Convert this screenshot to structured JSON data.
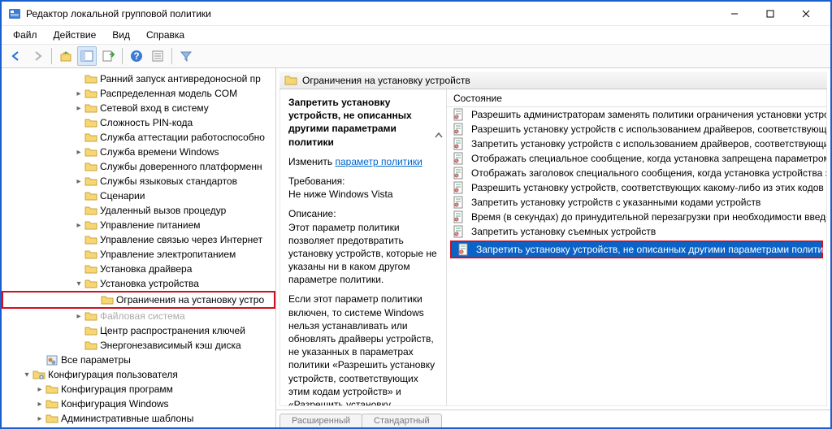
{
  "window": {
    "title": "Редактор локальной групповой политики"
  },
  "menu": {
    "file": "Файл",
    "action": "Действие",
    "view": "Вид",
    "help": "Справка"
  },
  "tree": {
    "items": [
      {
        "d": 5,
        "t": "",
        "label": "Ранний запуск антивредоносной пр"
      },
      {
        "d": 5,
        "t": ">",
        "label": "Распределенная модель COM"
      },
      {
        "d": 5,
        "t": ">",
        "label": "Сетевой вход в систему"
      },
      {
        "d": 5,
        "t": "",
        "label": "Сложность PIN-кода"
      },
      {
        "d": 5,
        "t": "",
        "label": "Служба аттестации работоспособно"
      },
      {
        "d": 5,
        "t": ">",
        "label": "Служба времени Windows"
      },
      {
        "d": 5,
        "t": "",
        "label": "Службы доверенного платформенн"
      },
      {
        "d": 5,
        "t": ">",
        "label": "Службы языковых стандартов"
      },
      {
        "d": 5,
        "t": "",
        "label": "Сценарии"
      },
      {
        "d": 5,
        "t": "",
        "label": "Удаленный вызов процедур"
      },
      {
        "d": 5,
        "t": ">",
        "label": "Управление питанием"
      },
      {
        "d": 5,
        "t": "",
        "label": "Управление связью через Интернет"
      },
      {
        "d": 5,
        "t": "",
        "label": "Управление электропитанием"
      },
      {
        "d": 5,
        "t": "",
        "label": "Установка драйвера"
      },
      {
        "d": 5,
        "t": "v",
        "label": "Установка устройства"
      },
      {
        "d": 6,
        "t": "",
        "label": "Ограничения на установку устро",
        "boxed": true
      },
      {
        "d": 5,
        "t": ">",
        "label": "Файловая система",
        "faded": true
      },
      {
        "d": 5,
        "t": "",
        "label": "Центр распространения ключей"
      },
      {
        "d": 5,
        "t": "",
        "label": "Энергонезависимый кэш диска"
      }
    ],
    "allParams": {
      "d": 2,
      "label": "Все параметры"
    },
    "userCfg": {
      "d": 1,
      "t": "v",
      "label": "Конфигурация пользователя"
    },
    "cfgProg": {
      "d": 2,
      "t": ">",
      "label": "Конфигурация программ"
    },
    "winCfg": {
      "d": 2,
      "t": ">",
      "label": "Конфигурация Windows"
    },
    "adminTpl": {
      "d": 2,
      "t": ">",
      "label": "Административные шаблоны"
    }
  },
  "rightHeader": "Ограничения на установку устройств",
  "detail": {
    "title": "Запретить установку устройств, не описанных другими параметрами политики",
    "editPrefix": "Изменить",
    "editLink": "параметр политики",
    "reqLabel": "Требования:",
    "reqText": "Не ниже Windows Vista",
    "descLabel": "Описание:",
    "descText": "Этот параметр политики позволяет предотвратить установку устройств, которые не указаны ни в каком другом параметре политики.",
    "descText2": "Если этот параметр политики включен, то системе Windows нельзя устанавливать или обновлять драйверы устройств, не указанных в параметрах политики «Разрешить установку устройств, соответствующих этим кодам устройств» и «Разрешить установку устройств для этих классов"
  },
  "listHead": "Состояние",
  "listItems": [
    "Разрешить администраторам заменять политики ограничения установки устройств",
    "Разрешить установку устройств с использованием драйверов, соответствующих этим к",
    "Запретить установку устройств с использованием драйверов, соответствующих этим к",
    "Отображать специальное сообщение, когда установка запрещена параметром полит",
    "Отображать заголовок специального сообщения, когда установка устройства запреще",
    "Разрешить установку устройств, соответствующих какому-либо из этих кодов устройс",
    "Запретить установку устройств с указанными кодами устройств",
    "Время (в секундах) до принудительной перезагрузки при необходимости введения пар",
    "Запретить установку съемных устройств",
    "Запретить установку устройств, не описанных другими параметрами политики"
  ],
  "selectedIndex": 9,
  "tabs": {
    "ext": "Расширенный",
    "std": "Стандартный"
  }
}
